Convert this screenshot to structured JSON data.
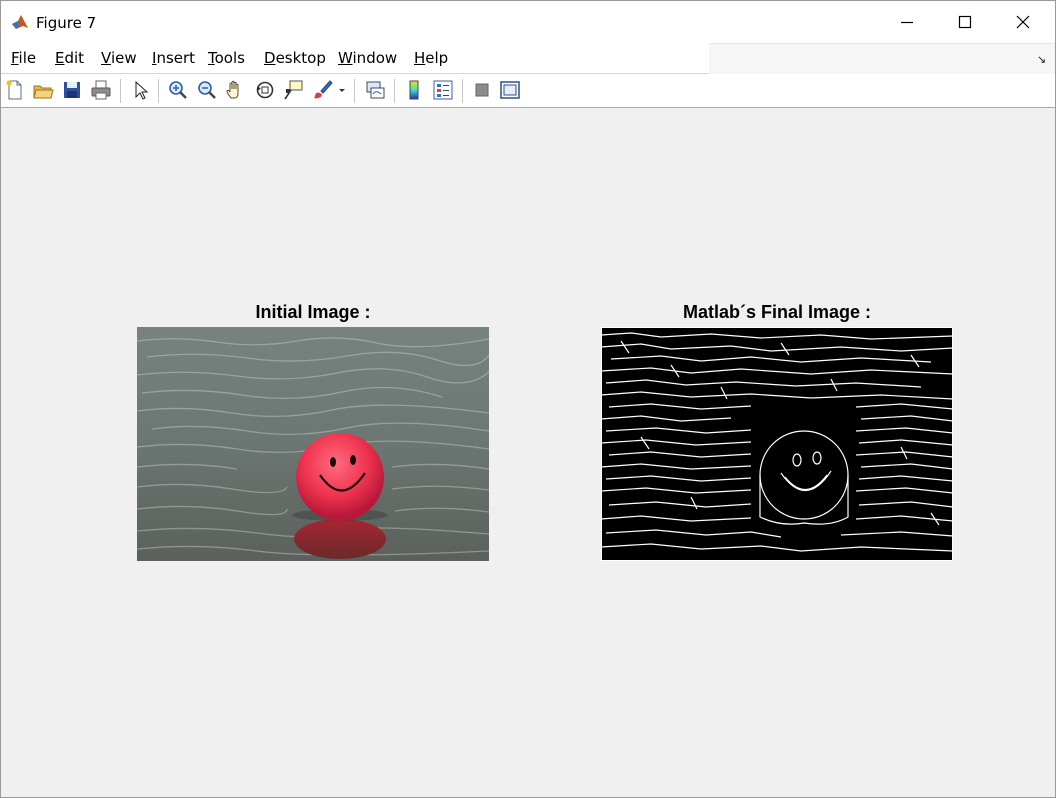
{
  "window": {
    "title": "Figure 7",
    "controls": {
      "minimize": "minimize",
      "maximize": "maximize",
      "close": "close"
    }
  },
  "menu": {
    "items": [
      {
        "underline": "F",
        "rest": "ile"
      },
      {
        "underline": "E",
        "rest": "dit"
      },
      {
        "underline": "V",
        "rest": "iew"
      },
      {
        "underline": "I",
        "rest": "nsert"
      },
      {
        "underline": "T",
        "rest": "ools"
      },
      {
        "underline": "D",
        "rest": "esktop"
      },
      {
        "underline": "W",
        "rest": "indow"
      },
      {
        "underline": "H",
        "rest": "elp"
      }
    ]
  },
  "toolbar": {
    "icons": [
      "new-figure-icon",
      "open-icon",
      "save-icon",
      "print-icon",
      "select-arrow-icon",
      "zoom-in-icon",
      "zoom-out-icon",
      "pan-hand-icon",
      "rotate-3d-icon",
      "data-cursor-icon",
      "brush-icon",
      "link-plot-icon",
      "colorbar-icon",
      "legend-icon",
      "hide-plot-tools-icon",
      "show-plot-tools-icon"
    ]
  },
  "figure": {
    "left_title": "Initial Image :",
    "right_title": "Matlab´s Final Image :"
  },
  "colors": {
    "window_bg": "#f0f0f0",
    "ball": "#f0344f",
    "water": "#6e7a76",
    "edges_bg": "#000000"
  }
}
